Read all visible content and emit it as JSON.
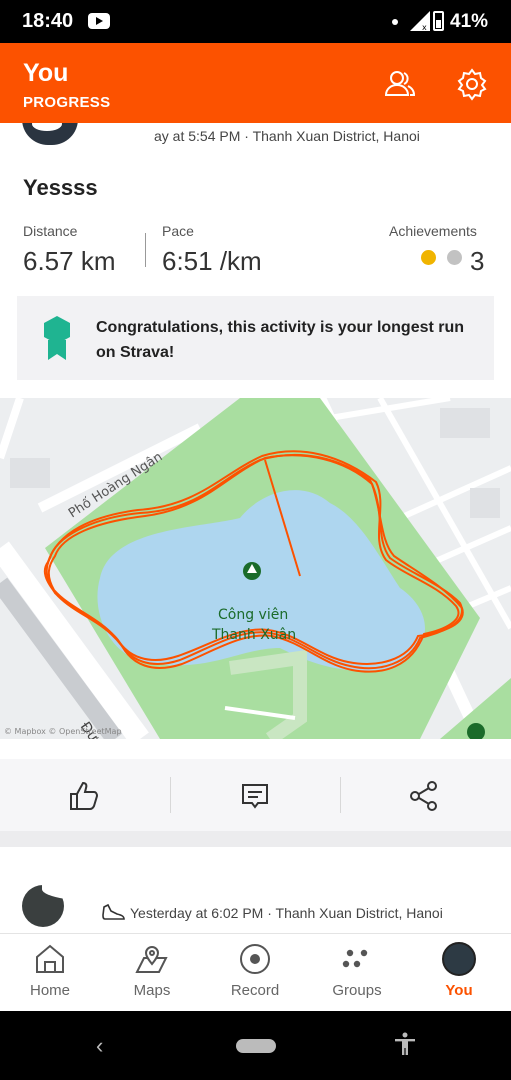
{
  "status_bar": {
    "time": "18:40",
    "battery": "41%"
  },
  "header": {
    "title": "You",
    "subtitle": "PROGRESS",
    "icons": [
      "people-icon",
      "settings-gear-icon"
    ]
  },
  "activity": {
    "meta": "ay at 5:54 PM · Thanh Xuan District, Hanoi",
    "title": "Yessss",
    "stats": [
      {
        "label": "Distance",
        "value": "6.57 km"
      },
      {
        "label": "Pace",
        "value": "6:51 /km"
      }
    ],
    "achievements": {
      "label": "Achievements",
      "count": "3"
    },
    "banner": "Congratulations, this activity is your longest run on Strava!",
    "map": {
      "street_label": "Phố Hoàng Ngân",
      "park_label_1": "Công viên",
      "park_label_2": "Thanh Xuân",
      "partial_label": "Đư",
      "attribution": "© Mapbox © OpenStreetMap",
      "route_color": "#fc5200",
      "water_color": "#aed6ef",
      "park_color": "#a9dea0"
    }
  },
  "actions": {
    "items": [
      "kudos-icon",
      "comment-icon",
      "share-icon"
    ]
  },
  "next_activity": {
    "meta": "Yesterday at 6:02 PM · Thanh Xuan District, Hanoi"
  },
  "bottom_nav": {
    "items": [
      {
        "label": "Home",
        "active": false
      },
      {
        "label": "Maps",
        "active": false
      },
      {
        "label": "Record",
        "active": false
      },
      {
        "label": "Groups",
        "active": false
      },
      {
        "label": "You",
        "active": true
      }
    ]
  }
}
